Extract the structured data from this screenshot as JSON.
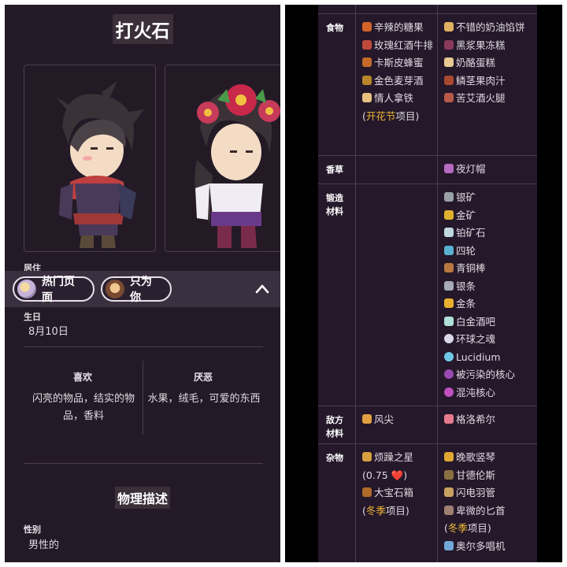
{
  "left": {
    "title": "打火石",
    "section_partial_label": "居住",
    "tabs": [
      {
        "label": "热门页面"
      },
      {
        "label": "只为你"
      }
    ],
    "birthday": {
      "label": "生日",
      "value": "8月10日"
    },
    "likes": {
      "label": "喜欢",
      "text": "闪亮的物品，结实的物品，香料"
    },
    "dislikes": {
      "label": "厌恶",
      "text": "水果，绒毛，可爱的东西"
    },
    "physical_section": "物理描述",
    "gender": {
      "label": "性别",
      "value": "男性的"
    }
  },
  "right": {
    "rows": [
      {
        "category": "食物",
        "col_a": [
          {
            "icon": "spicy-sugar-fruit-icon",
            "color": "#d4632a",
            "text": "辛辣的糖果"
          },
          {
            "icon": "rose-wine-steak-icon",
            "color": "#c04a3a",
            "text": "玫瑰红酒牛排"
          },
          {
            "icon": "casper-honey-icon",
            "color": "#c46a2a",
            "text": "卡斯皮蜂蜜"
          },
          {
            "icon": "golden-malt-wine-icon",
            "color": "#b8862a",
            "text": "金色麦芽酒"
          },
          {
            "icon": "lover-latte-icon",
            "color": "#e8c080",
            "text": "情人拿铁"
          }
        ],
        "col_a_note": {
          "prefix": "(",
          "link": "开花节",
          "suffix": "项目)"
        },
        "col_b": [
          {
            "icon": "cream-pie-icon",
            "color": "#e0b060",
            "text": "不错的奶油馅饼"
          },
          {
            "icon": "blackberry-jelly-cake-icon",
            "color": "#8a3a5a",
            "text": "黑浆果冻糕"
          },
          {
            "icon": "cheesecake-icon",
            "color": "#e8c890",
            "text": "奶酪蛋糕"
          },
          {
            "icon": "rhubarb-gravy-icon",
            "color": "#a84830",
            "text": "鳞茎果肉汁"
          },
          {
            "icon": "wormwood-ham-icon",
            "color": "#b85a4a",
            "text": "苦艾酒火腿"
          }
        ]
      },
      {
        "category": "香草",
        "col_a": [],
        "col_b": [
          {
            "icon": "nightlight-cap-icon",
            "color": "#b86ac0",
            "text": "夜灯帽"
          }
        ]
      },
      {
        "category": "锻造材料",
        "col_a": [],
        "col_b": [
          {
            "icon": "silver-ore-icon",
            "color": "#9aa0a8",
            "text": "银矿"
          },
          {
            "icon": "gold-ore-icon",
            "color": "#e0b030",
            "text": "金矿"
          },
          {
            "icon": "platinum-ore-icon",
            "color": "#c0d8e0",
            "text": "铂矿石"
          },
          {
            "icon": "four-wheel-icon",
            "color": "#5ab0d0",
            "text": "四轮"
          },
          {
            "icon": "bronze-bar-icon",
            "color": "#b87840",
            "text": "青铜棒"
          },
          {
            "icon": "silver-bar-icon",
            "color": "#a8acb4",
            "text": "银条"
          },
          {
            "icon": "gold-bar-icon",
            "color": "#e8b030",
            "text": "金条"
          },
          {
            "icon": "platinum-bar-icon",
            "color": "#b0e0d8",
            "text": "白金酒吧"
          },
          {
            "icon": "globe-soul-icon",
            "color": "#d8d8e8",
            "text": "环球之魂"
          },
          {
            "icon": "lucidium-icon",
            "color": "#70c8e8",
            "text": "Lucidium"
          },
          {
            "icon": "tainted-core-icon",
            "color": "#9a4ab0",
            "text": "被污染的核心"
          },
          {
            "icon": "chaos-core-icon",
            "color": "#c050c0",
            "text": "混沌核心"
          }
        ]
      },
      {
        "category": "敌方材料",
        "col_a": [
          {
            "icon": "wind-tip-icon",
            "color": "#e0a040",
            "text": "风尖"
          }
        ],
        "col_b": [
          {
            "icon": "grosh-icon",
            "color": "#e87a90",
            "text": "格洛希尔"
          }
        ]
      },
      {
        "category": "杂物",
        "col_a": [
          {
            "icon": "fussy-star-icon",
            "color": "#d8a040",
            "text": "烦躁之星"
          },
          {
            "icon": "treasure-chest-icon",
            "color": "#b06a2a",
            "text": "大宝石箱"
          }
        ],
        "col_a_heart": "(0.75 ❤️)",
        "col_a_note": {
          "prefix": "(",
          "link": "冬季",
          "suffix": "项目)"
        },
        "col_b": [
          {
            "icon": "lyre-icon",
            "color": "#e0a830",
            "text": "晚歌竖琴"
          },
          {
            "icon": "gandalos-icon",
            "color": "#8a7040",
            "text": "甘德伦斯"
          },
          {
            "icon": "lightning-quill-icon",
            "color": "#c8a060",
            "text": "闪电羽管"
          },
          {
            "icon": "humble-dagger-icon",
            "color": "#a08070",
            "text": "卑微的匕首"
          },
          {
            "icon": "ordo-choir-icon",
            "color": "#70a8d8",
            "text": "奥尔多唱机"
          }
        ],
        "col_b_note": {
          "prefix": "(",
          "link": "冬季",
          "suffix": "项目)"
        }
      }
    ]
  }
}
